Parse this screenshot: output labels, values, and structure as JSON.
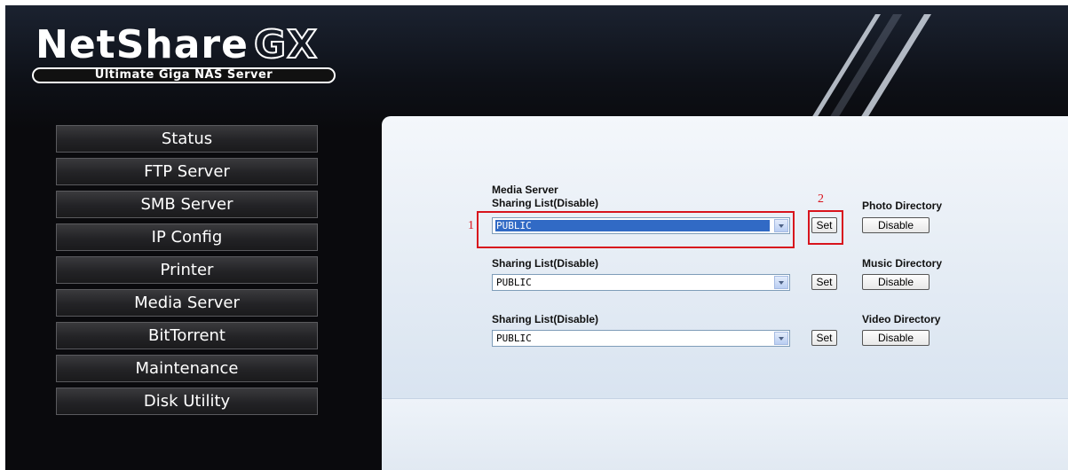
{
  "logo": {
    "brand": "NetShare",
    "brand_suffix": "GX",
    "tagline": "Ultimate Giga NAS Server"
  },
  "menu": [
    {
      "label": "Status"
    },
    {
      "label": "FTP Server"
    },
    {
      "label": "SMB Server"
    },
    {
      "label": "IP Config"
    },
    {
      "label": "Printer"
    },
    {
      "label": "Media Server"
    },
    {
      "label": "BitTorrent"
    },
    {
      "label": "Maintenance"
    },
    {
      "label": "Disk Utility"
    }
  ],
  "media": {
    "heading": "Media Server",
    "rows": [
      {
        "list_label": "Sharing List(Disable)",
        "selected": "PUBLIC",
        "set_label": "Set",
        "dir_label": "Photo Directory",
        "action_label": "Disable"
      },
      {
        "list_label": "Sharing List(Disable)",
        "selected": "PUBLIC",
        "set_label": "Set",
        "dir_label": "Music Directory",
        "action_label": "Disable"
      },
      {
        "list_label": "Sharing List(Disable)",
        "selected": "PUBLIC",
        "set_label": "Set",
        "dir_label": "Video Directory",
        "action_label": "Disable"
      }
    ]
  },
  "annotations": {
    "marker1": "1",
    "marker2": "2"
  },
  "colors": {
    "annotation": "#d8141d",
    "selection": "#316ac5",
    "background": "#0a0a0d"
  }
}
